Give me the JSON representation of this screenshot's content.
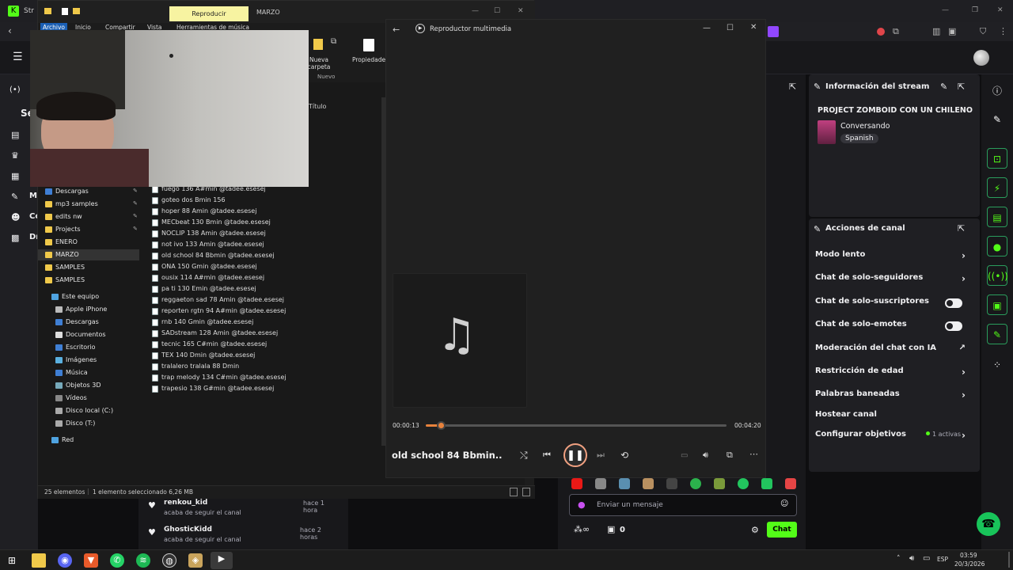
{
  "browser": {
    "tab_title": "Str",
    "controls": {
      "min": "—",
      "max": "❐",
      "close": "✕"
    }
  },
  "explorer": {
    "title_tab": "Reproducir",
    "window_title": "MARZO",
    "menu": [
      "Archivo",
      "Inicio",
      "Compartir",
      "Vista",
      "Herramientas de música"
    ],
    "ribbon": {
      "new_folder": "Nueva carpeta",
      "properties": "Propiedades",
      "group_new": "Nuevo"
    },
    "column_title": "Título",
    "nav_quick": [
      "Descargas",
      "mp3 samples",
      "edits nw",
      "Projects",
      "ENERO",
      "MARZO",
      "SAMPLES",
      "SAMPLES"
    ],
    "nav_pc_title": "Este equipo",
    "nav_pc": [
      "Apple iPhone",
      "Descargas",
      "Documentos",
      "Escritorio",
      "Imágenes",
      "Música",
      "Objetos 3D",
      "Vídeos",
      "Disco local (C:)",
      "Disco  (T:)"
    ],
    "nav_network": "Red",
    "files": [
      "fuego 136 A#min @tadee.esesej",
      "goteo dos Bmin 156",
      "hoper 88 Amin @tadee.esesej",
      "MECbeat 130 Bmin @tadee.esesej",
      "NOCLIP 138 Amin @tadee.esesej",
      "not ivo 133 Amin @tadee.esesej",
      "old school 84 Bbmin @tadee.esesej",
      "ONA 150 Gmin @tadee.esesej",
      "ousix 114 A#min @tadee.esesej",
      "pa ti 130 Emin @tadee.esesej",
      "reggaeton sad 78 Amin @tadee.esesej",
      "reporten rgtn 94 A#min @tadee.esesej",
      "rnb 140 Gmin @tadee.esesej",
      "SADstream 128 Amin @tadee.esesej",
      "tecnic 165 C#min @tadee.esesej",
      "TEX 140 Dmin @tadee.esesej",
      "tralalero tralala 88 Dmin",
      "trap melody 134 C#min @tadee.esesej",
      "trapesio 138 G#min @tadee.esesej"
    ],
    "selected_file_index": 6,
    "status": {
      "count": "25 elementos",
      "selection": "1 elemento seleccionado  6,26 MB"
    }
  },
  "player": {
    "title": "Reproductor multimedia",
    "elapsed": "00:00:13",
    "total": "00:04:20",
    "progress": 0.05,
    "track": "old school 84 Bbmin..."
  },
  "twitch": {
    "sidebar_letters": [
      "Se",
      "M",
      "Co",
      "Dr"
    ],
    "stream_info": {
      "header": "Información del stream",
      "title": "PROJECT ZOMBOID CON UN CHILENO",
      "category": "Conversando",
      "tag": "Spanish"
    },
    "channel_actions": {
      "header": "Acciones de canal",
      "items": [
        {
          "label": "Modo lento"
        },
        {
          "label": "Chat de solo-seguidores"
        },
        {
          "label": "Chat de solo-suscriptores"
        },
        {
          "label": "Chat de solo-emotes"
        },
        {
          "label": "Moderación del chat con IA"
        },
        {
          "label": "Restricción de edad"
        },
        {
          "label": "Palabras baneadas"
        },
        {
          "label": "Hostear canal"
        },
        {
          "label": "Configurar objetivos",
          "badge": "1 activas"
        }
      ]
    },
    "activity": [
      {
        "user": "renkou_kid",
        "action": "acaba de seguir el canal",
        "time": "hace 1 hora"
      },
      {
        "user": "GhosticKidd",
        "action": "acaba de seguir el canal",
        "time": "hace 2 horas"
      }
    ],
    "chat": {
      "placeholder": "Enviar un mensaje",
      "points": "0",
      "button": "Chat"
    }
  },
  "taskbar": {
    "lang": "ESP",
    "time": "03:59",
    "date": "20/3/2026"
  }
}
